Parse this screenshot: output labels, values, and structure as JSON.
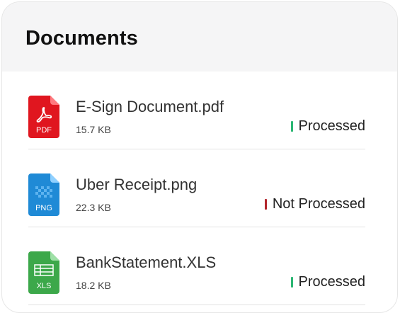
{
  "header": {
    "title": "Documents"
  },
  "documents": [
    {
      "name": "E-Sign Document.pdf",
      "size": "15.7 KB",
      "status": "Processed",
      "status_color": "#2bb673",
      "file_type": "PDF",
      "icon": "pdf-file-icon",
      "icon_color": "#e0161f"
    },
    {
      "name": "Uber Receipt.png",
      "size": "22.3 KB",
      "status": "Not Processed",
      "status_color": "#b3262c",
      "file_type": "PNG",
      "icon": "png-file-icon",
      "icon_color": "#1f8ad6"
    },
    {
      "name": "BankStatement.XLS",
      "size": "18.2 KB",
      "status": "Processed",
      "status_color": "#2bb673",
      "file_type": "XLS",
      "icon": "xls-file-icon",
      "icon_color": "#3ca84a"
    }
  ]
}
